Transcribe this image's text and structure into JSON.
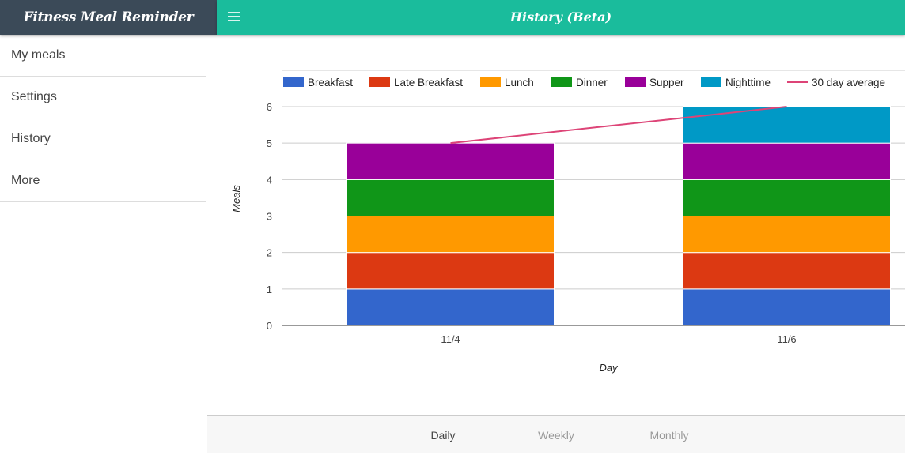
{
  "app": {
    "title": "Fitness Meal Reminder"
  },
  "header": {
    "title": "History (Beta)",
    "menu_icon": "hamburger-menu-icon"
  },
  "sidebar": {
    "items": [
      {
        "label": "My meals"
      },
      {
        "label": "Settings"
      },
      {
        "label": "History"
      },
      {
        "label": "More"
      }
    ]
  },
  "tabs": {
    "items": [
      {
        "label": "Daily",
        "active": true
      },
      {
        "label": "Weekly",
        "active": false
      },
      {
        "label": "Monthly",
        "active": false
      }
    ]
  },
  "colors": {
    "sidebar_header": "#3b4a58",
    "topbar": "#1abc9c"
  },
  "chart_data": {
    "type": "bar",
    "stacked": true,
    "title": "",
    "xlabel": "Day",
    "ylabel": "Meals",
    "ylim": [
      0,
      6
    ],
    "yticks": [
      0,
      1,
      2,
      3,
      4,
      5,
      6
    ],
    "grid": true,
    "legend_position": "top",
    "categories": [
      "11/4",
      "11/6"
    ],
    "series": [
      {
        "name": "Breakfast",
        "color": "#3366cc",
        "values": [
          1,
          1
        ]
      },
      {
        "name": "Late Breakfast",
        "color": "#dc3912",
        "values": [
          1,
          1
        ]
      },
      {
        "name": "Lunch",
        "color": "#ff9900",
        "values": [
          1,
          1
        ]
      },
      {
        "name": "Dinner",
        "color": "#109618",
        "values": [
          1,
          1
        ]
      },
      {
        "name": "Supper",
        "color": "#990099",
        "values": [
          1,
          1
        ]
      },
      {
        "name": "Nighttime",
        "color": "#0099c6",
        "values": [
          0,
          1
        ]
      }
    ],
    "line_series": {
      "name": "30 day average",
      "color": "#dd4477",
      "values": [
        5,
        6
      ]
    }
  }
}
